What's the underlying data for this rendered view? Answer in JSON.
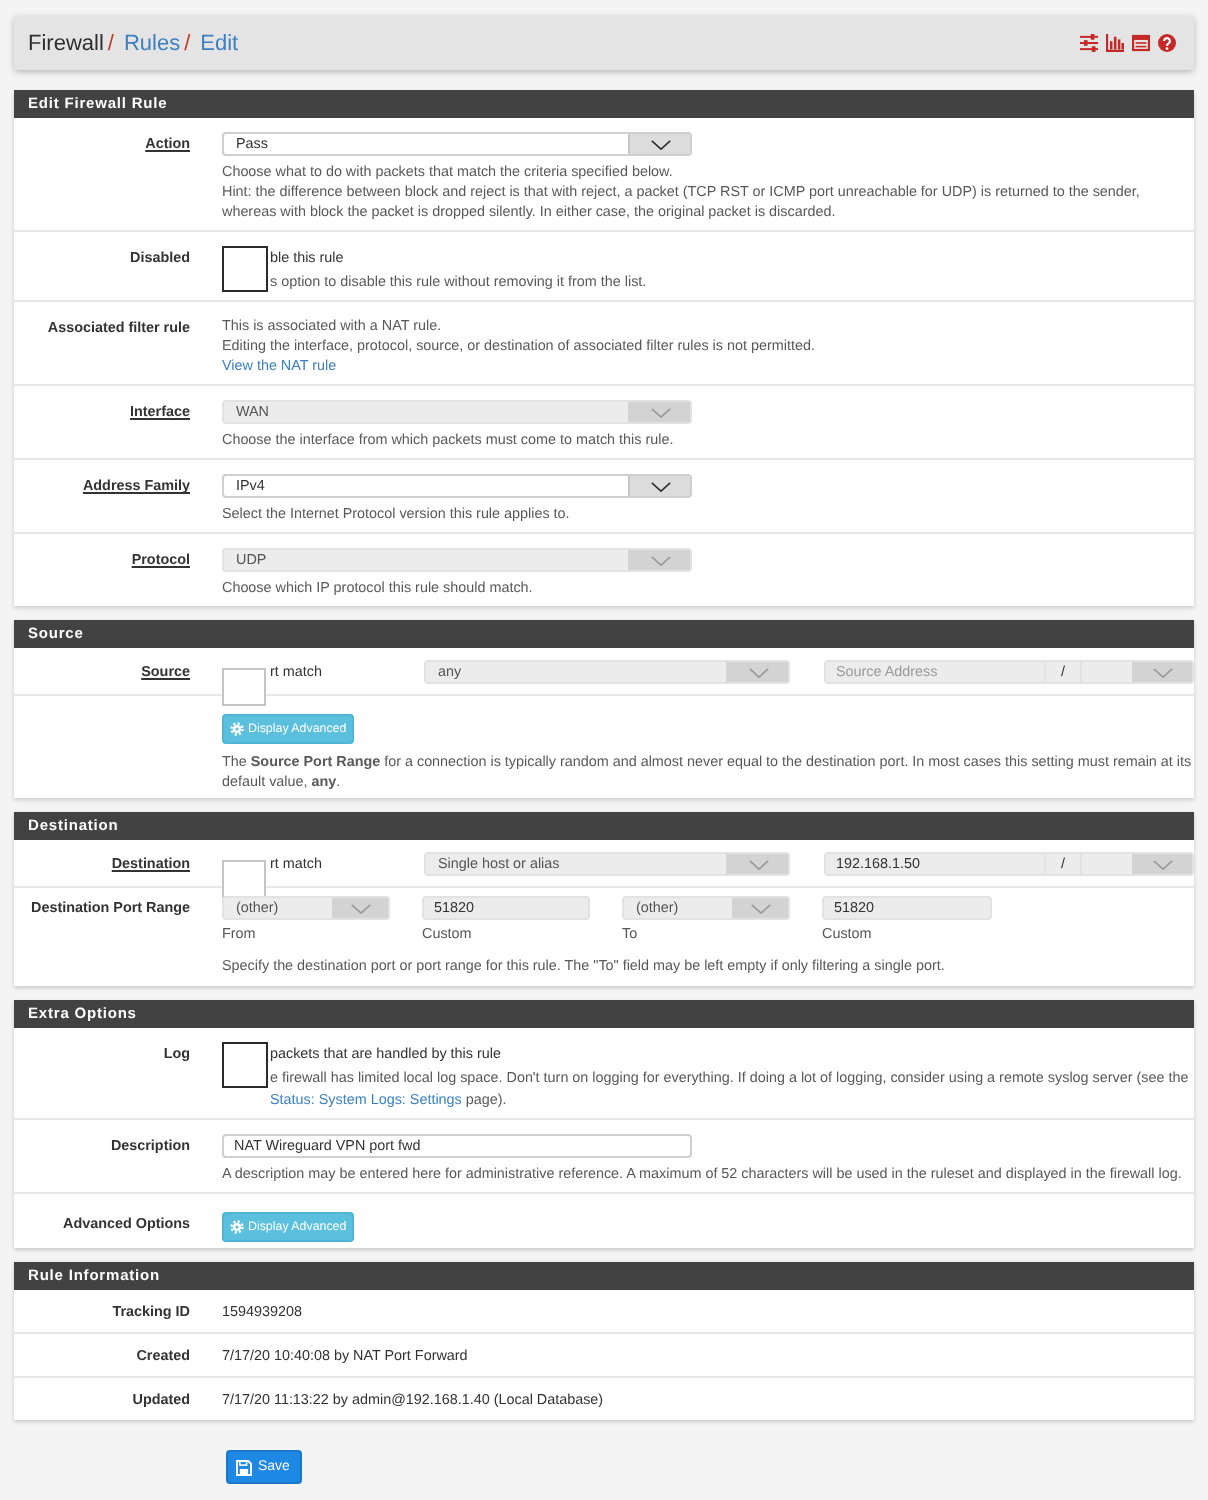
{
  "header": {
    "breadcrumbs": [
      {
        "label": "Firewall",
        "link": false,
        "separator": "/"
      },
      {
        "label": "Rules",
        "link": true,
        "separator": "/"
      },
      {
        "label": "Edit",
        "link": true
      }
    ]
  },
  "panels": [
    {
      "title": "Edit Firewall Rule",
      "rows": [
        {
          "kind": "select",
          "label": "Action",
          "required": true,
          "select": {
            "value": "Pass",
            "disabled": false
          },
          "help": [
            "Choose what to do with packets that match the criteria specified below.",
            "Hint: the difference between block and reject is that with reject, a packet (TCP RST or ICMP port unreachable for UDP) is returned to the sender, whereas with block the packet is dropped silently. In either case, the original packet is discarded."
          ]
        },
        {
          "kind": "checkbox",
          "label": "Disabled",
          "required": false,
          "checkbox": {
            "checked": false,
            "disabled": false
          },
          "text": "ble this rule",
          "help": {
            "text": "s option to disable this rule without removing it from the list."
          }
        },
        {
          "kind": "info",
          "label": "Associated filter rule",
          "required": false,
          "lines": [
            "This is associated with a NAT rule.",
            "Editing the interface, protocol, source, or destination of associated filter rules is not permitted."
          ],
          "link": "View the NAT rule"
        },
        {
          "kind": "select",
          "label": "Interface",
          "required": true,
          "select": {
            "value": "WAN",
            "disabled": true
          },
          "help": [
            "Choose the interface from which packets must come to match this rule."
          ]
        },
        {
          "kind": "select",
          "label": "Address Family",
          "required": true,
          "select": {
            "value": "IPv4",
            "disabled": false
          },
          "help": [
            "Select the Internet Protocol version this rule applies to."
          ]
        },
        {
          "kind": "select",
          "label": "Protocol",
          "required": true,
          "select": {
            "value": "UDP",
            "disabled": true
          },
          "help": [
            "Choose which IP protocol this rule should match."
          ]
        }
      ]
    },
    {
      "title": "Source",
      "rows": [
        {
          "kind": "address",
          "label": "Source",
          "required": true,
          "invert": {
            "checked": false,
            "disabled": true
          },
          "invert_text": "rt match",
          "type": {
            "value": "any",
            "disabled": true
          },
          "address": {
            "placeholder": "Source Address",
            "disabled": true
          },
          "mask_separator": "/",
          "mask": {
            "disabled": true
          }
        },
        {
          "kind": "advanced",
          "button": "Display Advanced",
          "help": "The **Source Port Range** for a connection is typically random and almost never equal to the destination port. In most cases this setting must remain at its default value, **any**."
        }
      ]
    },
    {
      "title": "Destination",
      "rows": [
        {
          "kind": "address",
          "label": "Destination",
          "required": true,
          "invert": {
            "checked": false,
            "disabled": true
          },
          "invert_text": "rt match",
          "type": {
            "value": "Single host or alias",
            "disabled": true
          },
          "address": {
            "value": "192.168.1.50",
            "disabled": true
          },
          "mask_separator": "/",
          "mask": {
            "disabled": true
          }
        },
        {
          "kind": "ports",
          "label": "Destination Port Range",
          "required": false,
          "fields": [
            {
              "kind": "select",
              "value": "(other)",
              "disabled": true,
              "caption": "From"
            },
            {
              "kind": "input",
              "value": "51820",
              "disabled": true,
              "caption": "Custom"
            },
            {
              "kind": "select",
              "value": "(other)",
              "disabled": true,
              "caption": "To"
            },
            {
              "kind": "input",
              "value": "51820",
              "disabled": true,
              "caption": "Custom"
            }
          ],
          "help": "Specify the destination port or port range for this rule. The \"To\" field may be left empty if only filtering a single port."
        }
      ]
    },
    {
      "title": "Extra Options",
      "rows": [
        {
          "kind": "checkbox",
          "label": "Log",
          "required": false,
          "checkbox": {
            "checked": false,
            "disabled": false
          },
          "text": "packets that are handled by this rule",
          "help": {
            "text": "e firewall has limited local log space. Don't turn on logging for everything. If doing a lot of logging, consider using a remote syslog server (see the",
            "link": "Status: System Logs: Settings",
            "after": "page)."
          }
        },
        {
          "kind": "input",
          "label": "Description",
          "required": false,
          "input": {
            "value": "NAT Wireguard VPN port fwd",
            "disabled": false
          },
          "help": "A description may be entered here for administrative reference. A maximum of 52 characters will be used in the ruleset and displayed in the firewall log."
        },
        {
          "kind": "button",
          "label": "Advanced Options",
          "required": false,
          "button": "Display Advanced"
        }
      ]
    },
    {
      "title": "Rule Information",
      "rows": [
        {
          "kind": "static",
          "label": "Tracking ID",
          "required": false,
          "value": "1594939208"
        },
        {
          "kind": "static",
          "label": "Created",
          "required": false,
          "value": "7/17/20 10:40:08 by NAT Port Forward"
        },
        {
          "kind": "static",
          "label": "Updated",
          "required": false,
          "value": "7/17/20 11:13:22 by admin@192.168.1.40 (Local Database)"
        }
      ]
    }
  ],
  "save": {
    "label": "Save"
  }
}
